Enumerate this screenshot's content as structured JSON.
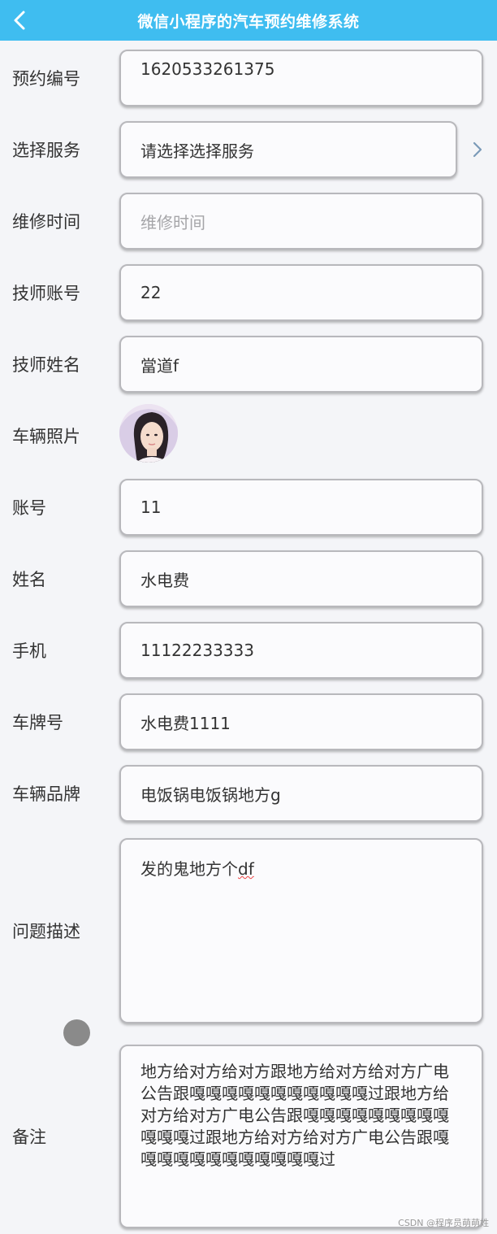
{
  "header": {
    "title": "微信小程序的汽车预约维修系统"
  },
  "form": {
    "booking_no": {
      "label": "预约编号",
      "value": "1620533261375"
    },
    "service": {
      "label": "选择服务",
      "value": "请选择选择服务"
    },
    "repair_time": {
      "label": "维修时间",
      "placeholder": "维修时间"
    },
    "tech_account": {
      "label": "技师账号",
      "value": "22"
    },
    "tech_name": {
      "label": "技师姓名",
      "value": "當道f"
    },
    "vehicle_photo": {
      "label": "车辆照片"
    },
    "account": {
      "label": "账号",
      "value": "11"
    },
    "name": {
      "label": "姓名",
      "value": "水电费"
    },
    "phone": {
      "label": "手机",
      "value": "11122233333"
    },
    "plate": {
      "label": "车牌号",
      "value": "水电费1111"
    },
    "brand": {
      "label": "车辆品牌",
      "value": "电饭锅电饭锅地方g"
    },
    "problem": {
      "label": "问题描述",
      "value_main": "发的鬼地方个",
      "value_flagged": "df"
    },
    "notes": {
      "label": "备注",
      "value": "地方给对方给对方跟地方给对方给对方广电公告跟嘎嘎嘎嘎嘎嘎嘎嘎嘎嘎嘎过跟地方给对方给对方广电公告跟嘎嘎嘎嘎嘎嘎嘎嘎嘎嘎嘎嘎过跟地方给对方给对方广电公告跟嘎嘎嘎嘎嘎嘎嘎嘎嘎嘎嘎嘎过"
    }
  },
  "watermark": "CSDN @程序员萌萌姓",
  "colors": {
    "header_bg": "#3fbdf0",
    "page_bg": "#f4f5f8",
    "field_border": "#b8b8bc"
  },
  "icons": {
    "back": "chevron-left-icon",
    "service_arrow": "chevron-right-icon"
  }
}
